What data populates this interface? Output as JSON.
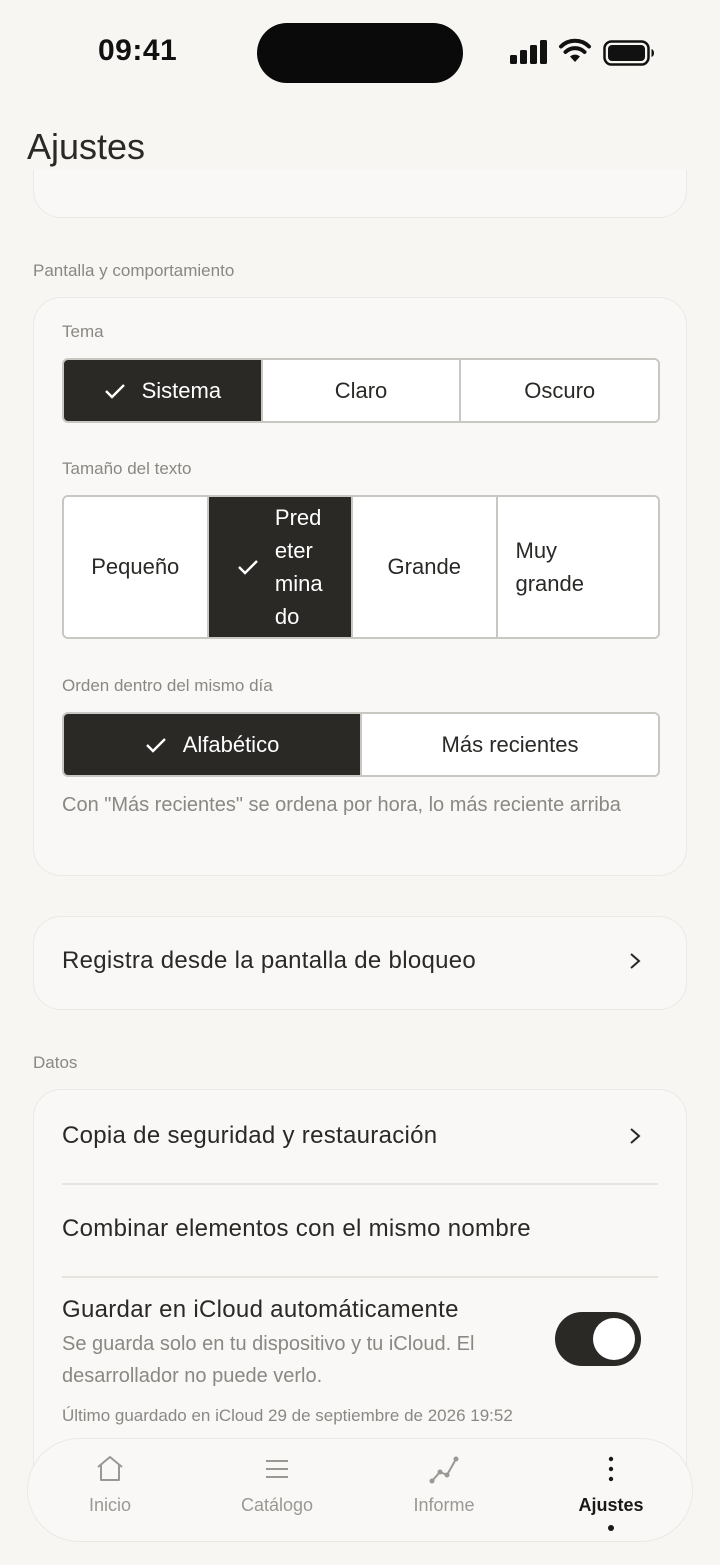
{
  "status_bar": {
    "time": "09:41"
  },
  "header": {
    "title": "Ajustes"
  },
  "display_section": {
    "label": "Pantalla y comportamiento",
    "theme": {
      "label": "Tema",
      "options": [
        "Sistema",
        "Claro",
        "Oscuro"
      ],
      "selected": "Sistema"
    },
    "text_size": {
      "label": "Tamaño del texto",
      "options": [
        "Pequeño",
        "Pred\neter\nmina\ndo",
        "Grande",
        "Muy\ngrande"
      ],
      "selected_index": 1
    },
    "order": {
      "label": "Orden dentro del mismo día",
      "options": [
        "Alfabético",
        "Más recientes"
      ],
      "selected": "Alfabético",
      "help": "Con \"Más recientes\" se ordena por hora, lo más reciente arriba"
    }
  },
  "lock_screen": {
    "label": "Registra desde la pantalla de bloqueo"
  },
  "data_section": {
    "label": "Datos",
    "backup": "Copia de seguridad y restauración",
    "merge": "Combinar elementos con el mismo nombre",
    "icloud": {
      "title": "Guardar en iCloud automáticamente",
      "description": "Se guarda solo en tu dispositivo y tu iCloud. El desarrollador no puede verlo.",
      "enabled": true,
      "last_saved": "Último guardado en iCloud 29 de septiembre de 2026 19:52"
    }
  },
  "tab_bar": {
    "items": [
      {
        "label": "Inicio",
        "icon": "home-icon"
      },
      {
        "label": "Catálogo",
        "icon": "list-icon"
      },
      {
        "label": "Informe",
        "icon": "chart-line-icon"
      },
      {
        "label": "Ajustes",
        "icon": "more-vertical-icon"
      }
    ],
    "active_index": 3
  },
  "colors": {
    "accent": "#2a2926",
    "background": "#f7f6f3",
    "muted_text": "#8a8883"
  }
}
